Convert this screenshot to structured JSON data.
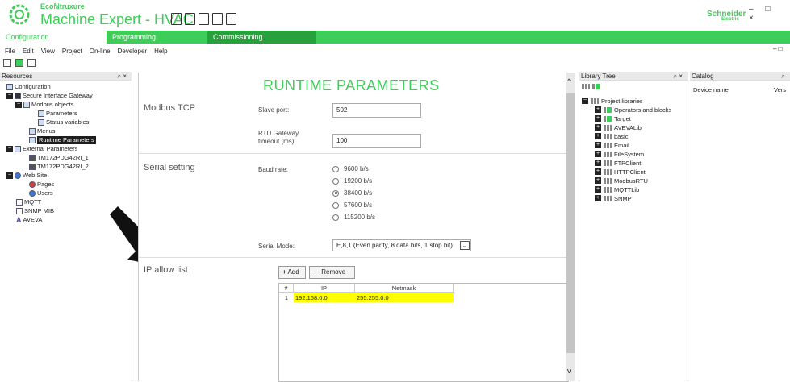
{
  "titlebar": {
    "brand_top": "Ecoℕtruxure",
    "app_name": "Machine Expert - HVAC",
    "vendor": "Schneider",
    "vendor_sub": "Electric",
    "win_controls": "– □ ×"
  },
  "tabs": [
    {
      "label": "Configuration"
    },
    {
      "label": "Programming"
    },
    {
      "label": "Commissioning"
    }
  ],
  "menubar": {
    "items": [
      "File",
      "Edit",
      "View",
      "Project",
      "On-line",
      "Developer",
      "Help"
    ],
    "right": "– □"
  },
  "resources": {
    "title": "Resources",
    "pin": "⌕ ×",
    "tree": [
      {
        "label": "Configuration"
      },
      {
        "label": "Secure Interface Gateway"
      },
      {
        "label": "Modbus objects"
      },
      {
        "label": "Parameters"
      },
      {
        "label": "Status variables"
      },
      {
        "label": "Menus"
      },
      {
        "label": "Runtime Parameters"
      },
      {
        "label": "External Parameters"
      },
      {
        "label": "TM172PDG42RI_1"
      },
      {
        "label": "TM172PDG42RI_2"
      },
      {
        "label": "Web Site"
      },
      {
        "label": "Pages"
      },
      {
        "label": "Users"
      },
      {
        "label": "MQTT"
      },
      {
        "label": "SNMP MIB"
      },
      {
        "label": "AVEVA"
      }
    ]
  },
  "main": {
    "title": "RUNTIME PARAMETERS",
    "modbus": {
      "section": "Modbus TCP",
      "slave_port_label": "Slave port:",
      "slave_port_value": "502",
      "rtu_timeout_label_1": "RTU Gateway",
      "rtu_timeout_label_2": "timeout (ms):",
      "rtu_timeout_value": "100"
    },
    "serial": {
      "section": "Serial setting",
      "baud_label": "Baud rate:",
      "baud_options": [
        "9600 b/s",
        "19200 b/s",
        "38400 b/s",
        "57600 b/s",
        "115200 b/s"
      ],
      "baud_selected": "38400 b/s",
      "mode_label": "Serial Mode:",
      "mode_value": "E,8,1 (Even parity, 8 data bits, 1 stop bit)"
    },
    "ip": {
      "section": "IP allow list",
      "add_label": "Add",
      "remove_label": "Remove",
      "columns": [
        "#",
        "IP",
        "Netmask"
      ],
      "rows": [
        {
          "num": "1",
          "ip": "192.168.0.0",
          "mask": "255.255.0.0"
        }
      ]
    }
  },
  "library": {
    "title": "Library Tree",
    "pin": "⌕ ×",
    "root": "Project libraries",
    "items": [
      "Operators and blocks",
      "Target",
      "AVEVALib",
      "basic",
      "Email",
      "FileSystem",
      "FTPClient",
      "HTTPClient",
      "ModbusRTU",
      "MQTTLib",
      "SNMP"
    ]
  },
  "catalog": {
    "title": "Catalog",
    "pin": "⌕",
    "col1": "Device name",
    "col2": "Vers"
  },
  "colors": {
    "brand_green": "#3dcd58",
    "highlight_yellow": "#ffff00"
  }
}
